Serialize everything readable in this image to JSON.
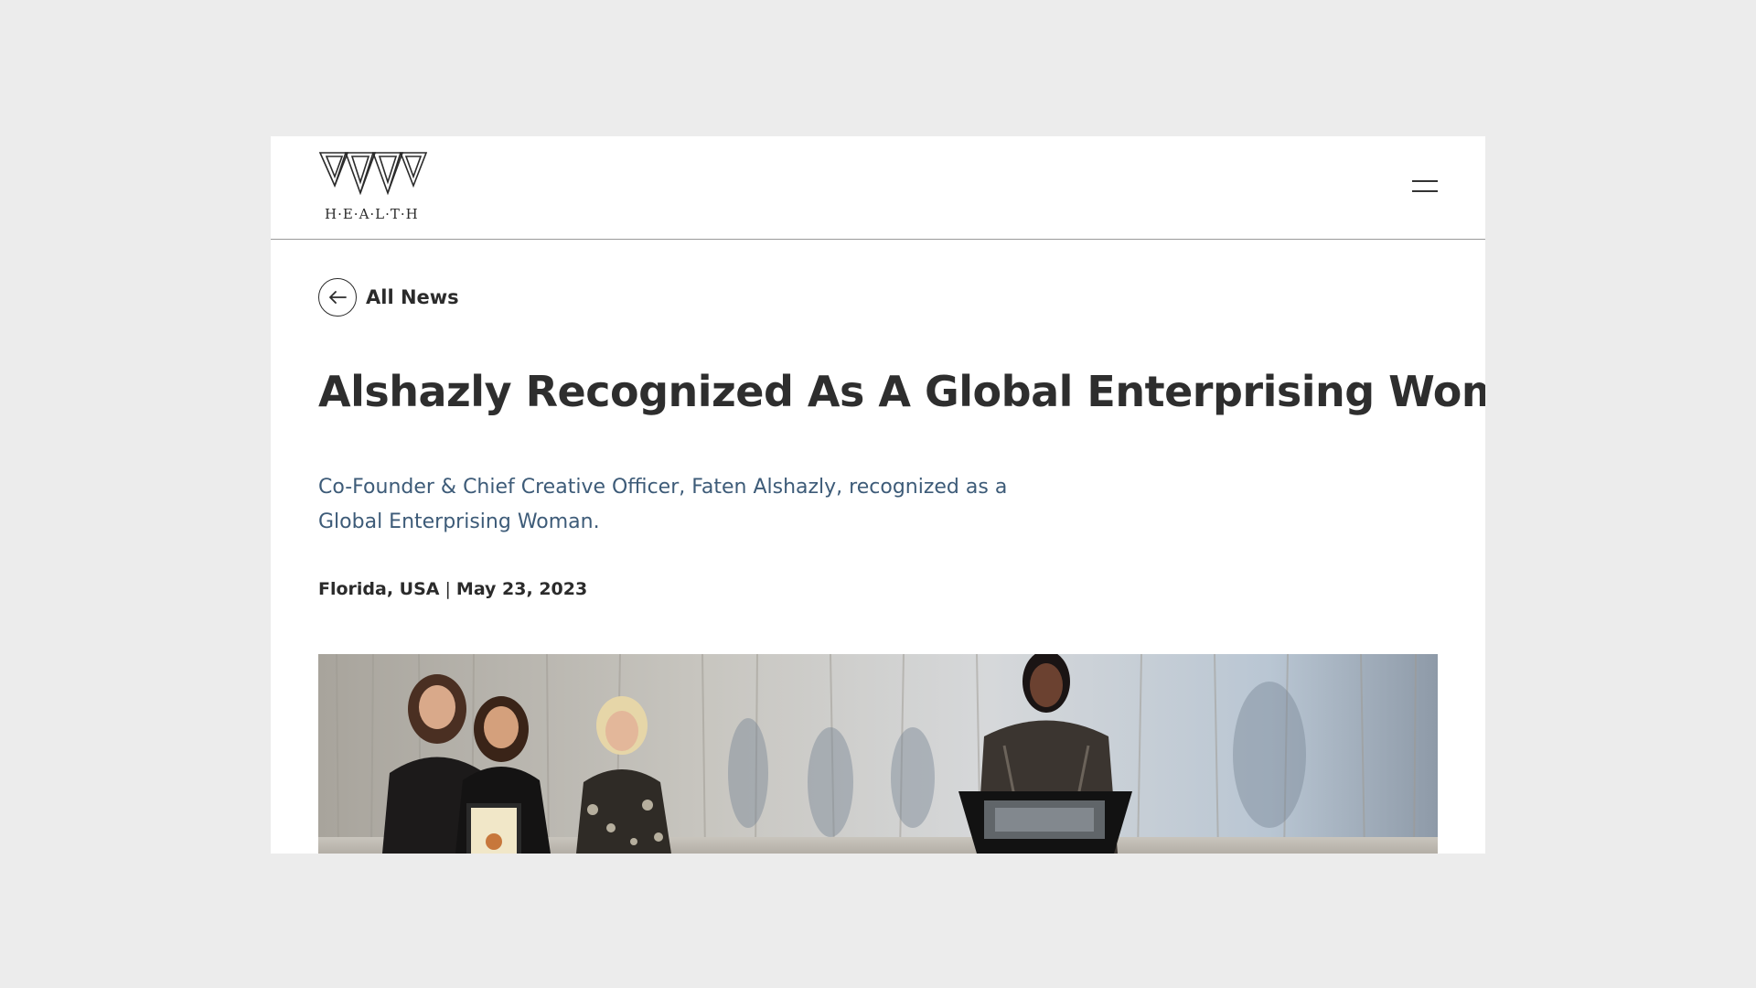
{
  "brand": {
    "logo_text": "H·E·A·L·T·H"
  },
  "nav": {
    "back_label": "All News"
  },
  "article": {
    "title": "Alshazly Recognized As A Global Enterprising Woman",
    "subtitle": "Co-Founder & Chief Creative Officer, Faten Alshazly, recognized as a Global Enterprising Woman.",
    "location": "Florida, USA",
    "separator": "|",
    "date": "May 23, 2023"
  },
  "icons": {
    "menu": "hamburger-menu-icon",
    "back": "arrow-left-icon"
  },
  "colors": {
    "page_bg": "#ececec",
    "card_bg": "#ffffff",
    "subtitle": "#3d5b78",
    "text": "#2b2b2b"
  }
}
